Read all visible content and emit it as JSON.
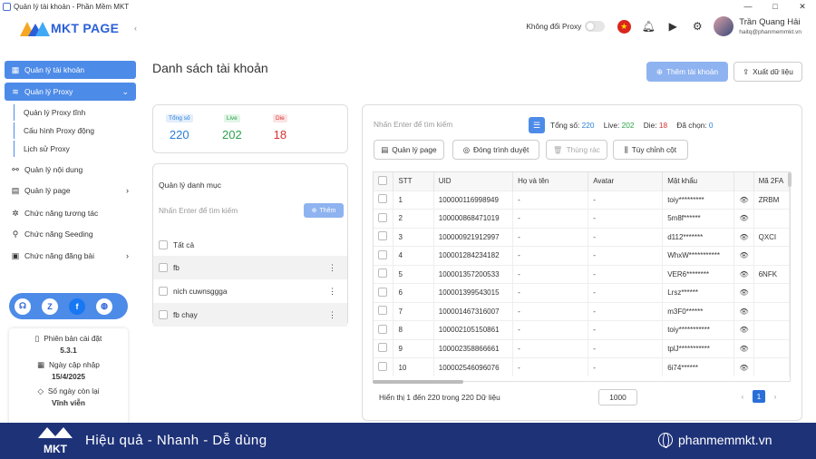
{
  "window": {
    "title": "Quản lý tài khoản - Phần Mềm MKT",
    "controls": [
      "—",
      "□",
      "✕"
    ]
  },
  "brand": {
    "logo_text": "MKT PAGE"
  },
  "sidebar": {
    "items": [
      {
        "label": "Quản lý tài khoản"
      },
      {
        "label": "Quản lý Proxy"
      },
      {
        "label": "Quản lý nội dung"
      },
      {
        "label": "Quản lý page"
      },
      {
        "label": "Chức năng tương tác"
      },
      {
        "label": "Chức năng Seeding"
      },
      {
        "label": "Chức năng đăng bài"
      }
    ],
    "proxy_sub": [
      {
        "label": "Quản lý Proxy tĩnh"
      },
      {
        "label": "Cấu hình Proxy động"
      },
      {
        "label": "Lịch sử Proxy"
      }
    ],
    "version": {
      "version_label": "Phiên bản cài đặt",
      "version_value": "5.3.1",
      "update_label": "Ngày cập nhập",
      "update_value": "15/4/2025",
      "remaining_label": "Số ngày còn lại",
      "remaining_value": "Vĩnh viễn"
    }
  },
  "header": {
    "proxy_toggle_label": "Không đổi Proxy",
    "user_name": "Trần Quang Hải",
    "user_email": "haitq@phanmemmkt.vn"
  },
  "page": {
    "title": "Danh sách tài khoản",
    "add_account": "Thêm tài khoản",
    "export": "Xuất dữ liệu"
  },
  "stats": {
    "total_label": "Tổng số",
    "total": "220",
    "live_label": "Live",
    "live": "202",
    "die_label": "Die",
    "die": "18"
  },
  "categories": {
    "title": "Quản lý danh mục",
    "search_placeholder": "Nhấn Enter để tìm kiếm",
    "add_label": "Thêm",
    "items": [
      {
        "label": "Tất cả"
      },
      {
        "label": "fb"
      },
      {
        "label": "nich cuwnsggga"
      },
      {
        "label": "fb chạy"
      }
    ]
  },
  "accounts": {
    "search_placeholder": "Nhấn Enter để tìm kiếm",
    "summary": {
      "total_label": "Tổng số:",
      "total": "220",
      "live_label": "Live:",
      "live": "202",
      "die_label": "Die:",
      "die": "18",
      "selected_label": "Đã chọn:",
      "selected": "0"
    },
    "actions": {
      "manage_page": "Quản lý page",
      "close_browser": "Đóng trình duyệt",
      "trash": "Thùng rác",
      "customize_cols": "Tùy chỉnh cột"
    },
    "columns": [
      "STT",
      "UID",
      "Họ và tên",
      "Avatar",
      "Mật khẩu",
      "Mã 2FA"
    ],
    "rows": [
      {
        "stt": "1",
        "uid": "100000116998949",
        "name": "-",
        "avatar": "-",
        "password": "toiy*********",
        "twofa": "ZRBM"
      },
      {
        "stt": "2",
        "uid": "100000868471019",
        "name": "-",
        "avatar": "-",
        "password": "5m8f******",
        "twofa": ""
      },
      {
        "stt": "3",
        "uid": "100000921912997",
        "name": "-",
        "avatar": "-",
        "password": "d112*******",
        "twofa": "QXCI"
      },
      {
        "stt": "4",
        "uid": "100001284234182",
        "name": "-",
        "avatar": "-",
        "password": "WhxW***********",
        "twofa": ""
      },
      {
        "stt": "5",
        "uid": "100001357200533",
        "name": "-",
        "avatar": "-",
        "password": "VER6********",
        "twofa": "6NFK"
      },
      {
        "stt": "6",
        "uid": "100001399543015",
        "name": "-",
        "avatar": "-",
        "password": "Lrsz******",
        "twofa": ""
      },
      {
        "stt": "7",
        "uid": "100001467316007",
        "name": "-",
        "avatar": "-",
        "password": "m3F0******",
        "twofa": ""
      },
      {
        "stt": "8",
        "uid": "100002105150861",
        "name": "-",
        "avatar": "-",
        "password": "toiy***********",
        "twofa": ""
      },
      {
        "stt": "9",
        "uid": "100002358866661",
        "name": "-",
        "avatar": "-",
        "password": "tplJ***********",
        "twofa": ""
      },
      {
        "stt": "10",
        "uid": "100002546096076",
        "name": "-",
        "avatar": "-",
        "password": "6i74******",
        "twofa": ""
      }
    ],
    "footer_info": "Hiển thị 1 đến 220 trong 220 Dữ liệu",
    "page_size": "1000",
    "current_page": "1",
    "prev": "‹",
    "next": "›"
  },
  "banner": {
    "logo_text": "MKT",
    "slogan": "Hiệu quả - Nhanh - Dễ dùng",
    "site": "phanmemmkt.vn"
  },
  "colors": {
    "primary": "#4d8be8",
    "banner": "#1e3278",
    "live": "#2aa14a",
    "die": "#d93030",
    "total": "#2a7fd8"
  }
}
